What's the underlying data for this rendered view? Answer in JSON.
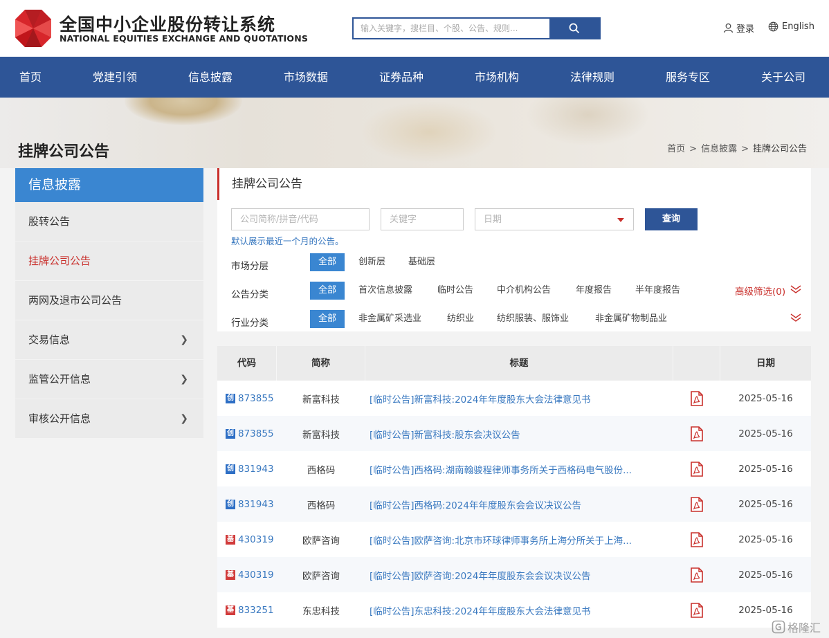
{
  "header": {
    "logo_cn": "全国中小企业股份转让系统",
    "logo_en": "NATIONAL EQUITIES EXCHANGE AND QUOTATIONS",
    "search_placeholder": "输入关键字，搜栏目、个股、公告、规则...",
    "login": "登录",
    "language": "English"
  },
  "nav": [
    "首页",
    "党建引领",
    "信息披露",
    "市场数据",
    "证券品种",
    "市场机构",
    "法律规则",
    "服务专区",
    "关于公司"
  ],
  "page": {
    "title": "挂牌公司公告",
    "breadcrumb": [
      "首页",
      "信息披露",
      "挂牌公司公告"
    ]
  },
  "sidebar": {
    "heading": "信息披露",
    "items": [
      {
        "label": "股转公告",
        "has_arrow": false
      },
      {
        "label": "挂牌公司公告",
        "has_arrow": false,
        "active": true
      },
      {
        "label": "两网及退市公司公告",
        "has_arrow": false
      },
      {
        "label": "交易信息",
        "has_arrow": true
      },
      {
        "label": "监管公开信息",
        "has_arrow": true
      },
      {
        "label": "审核公开信息",
        "has_arrow": true
      }
    ]
  },
  "filters": {
    "panel_title": "挂牌公司公告",
    "company_placeholder": "公司简称/拼音/代码",
    "keyword_placeholder": "关键字",
    "date_placeholder": "日期",
    "query_button": "查询",
    "hint": "默认展示最近一个月的公告。",
    "market_label": "市场分层",
    "market_options": [
      "全部",
      "创新层",
      "基础层"
    ],
    "category_label": "公告分类",
    "category_options": [
      "全部",
      "首次信息披露",
      "临时公告",
      "中介机构公告",
      "年度报告",
      "半年度报告"
    ],
    "industry_label": "行业分类",
    "industry_options": [
      "全部",
      "非金属矿采选业",
      "纺织业",
      "纺织服装、服饰业",
      "非金属矿物制品业"
    ],
    "advanced": "高级筛选(0)"
  },
  "table": {
    "headers": [
      "代码",
      "简称",
      "标题",
      "",
      "日期"
    ],
    "rows": [
      {
        "tag": "创",
        "tag_color": "#2e6fc5",
        "code": "873855",
        "name": "新富科技",
        "title": "[临时公告]新富科技:2024年年度股东大会法律意见书",
        "date": "2025-05-16"
      },
      {
        "tag": "创",
        "tag_color": "#2e6fc5",
        "code": "873855",
        "name": "新富科技",
        "title": "[临时公告]新富科技:股东会决议公告",
        "date": "2025-05-16"
      },
      {
        "tag": "创",
        "tag_color": "#2e6fc5",
        "code": "831943",
        "name": "西格码",
        "title": "[临时公告]西格码:湖南翰骏程律师事务所关于西格码电气股份...",
        "date": "2025-05-16"
      },
      {
        "tag": "创",
        "tag_color": "#2e6fc5",
        "code": "831943",
        "name": "西格码",
        "title": "[临时公告]西格码:2024年年度股东会会议决议公告",
        "date": "2025-05-16"
      },
      {
        "tag": "基",
        "tag_color": "#d13b3b",
        "code": "430319",
        "name": "欧萨咨询",
        "title": "[临时公告]欧萨咨询:北京市环球律师事务所上海分所关于上海...",
        "date": "2025-05-16"
      },
      {
        "tag": "基",
        "tag_color": "#d13b3b",
        "code": "430319",
        "name": "欧萨咨询",
        "title": "[临时公告]欧萨咨询:2024年年度股东会会议决议公告",
        "date": "2025-05-16"
      },
      {
        "tag": "基",
        "tag_color": "#d13b3b",
        "code": "833251",
        "name": "东忠科技",
        "title": "[临时公告]东忠科技:2024年年度股东大会法律意见书",
        "date": "2025-05-16"
      }
    ]
  },
  "watermark": "格隆汇",
  "colors": {
    "brand_blue": "#2e5597",
    "accent_blue": "#3a86d1",
    "accent_red": "#c9302c",
    "link_blue": "#3a79c0"
  }
}
